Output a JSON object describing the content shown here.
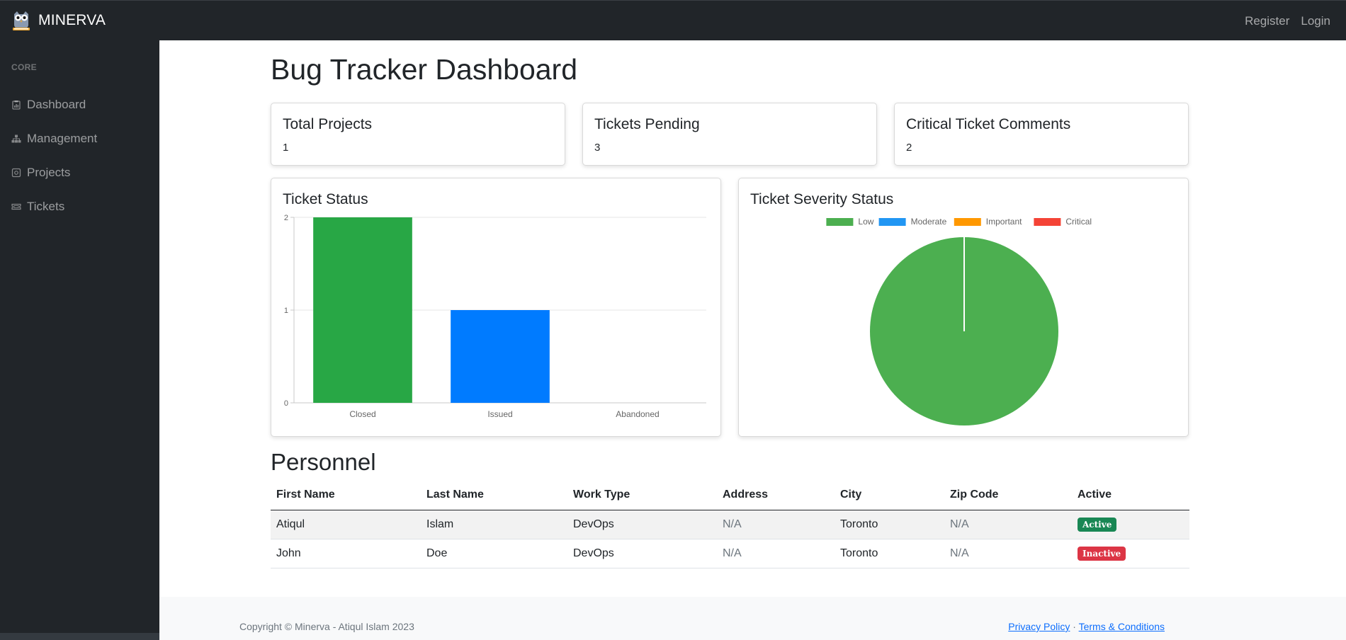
{
  "navbar": {
    "brand": "MINERVA",
    "links": [
      "Register",
      "Login"
    ]
  },
  "sidebar": {
    "heading": "CORE",
    "items": [
      {
        "label": "Dashboard",
        "icon": "clipboard-icon"
      },
      {
        "label": "Management",
        "icon": "sitemap-icon"
      },
      {
        "label": "Projects",
        "icon": "project-icon"
      },
      {
        "label": "Tickets",
        "icon": "ticket-icon"
      }
    ]
  },
  "page": {
    "title": "Bug Tracker Dashboard"
  },
  "stats": [
    {
      "title": "Total Projects",
      "value": "1"
    },
    {
      "title": "Tickets Pending",
      "value": "3"
    },
    {
      "title": "Critical Ticket Comments",
      "value": "2"
    }
  ],
  "charts": {
    "status_title": "Ticket Status",
    "severity_title": "Ticket Severity Status"
  },
  "chart_data": [
    {
      "type": "bar",
      "title": "Ticket Status",
      "categories": [
        "Closed",
        "Issued",
        "Abandoned"
      ],
      "values": [
        2,
        1,
        0
      ],
      "colors": [
        "#28a745",
        "#007bff",
        "#ffc107"
      ],
      "ylim": [
        0,
        2
      ],
      "yticks": [
        "0",
        "1",
        "2"
      ],
      "grid": true,
      "legend": "none"
    },
    {
      "type": "pie",
      "title": "Ticket Severity Status",
      "labels": [
        "Low",
        "Moderate",
        "Important",
        "Critical"
      ],
      "values": [
        1,
        0,
        0,
        0
      ],
      "colors": [
        "#4caf50",
        "#2196f3",
        "#ff9800",
        "#f44336"
      ],
      "legend": "top"
    }
  ],
  "personnel": {
    "title": "Personnel",
    "columns": [
      "First Name",
      "Last Name",
      "Work Type",
      "Address",
      "City",
      "Zip Code",
      "Active"
    ],
    "rows": [
      {
        "first": "Atiqul",
        "last": "Islam",
        "work": "DevOps",
        "address": "N/A",
        "city": "Toronto",
        "zip": "N/A",
        "active": "Active",
        "active_color": "#198754"
      },
      {
        "first": "John",
        "last": "Doe",
        "work": "DevOps",
        "address": "N/A",
        "city": "Toronto",
        "zip": "N/A",
        "active": "Inactive",
        "active_color": "#dc3545"
      }
    ]
  },
  "footer": {
    "copyright": "Copyright © Minerva - Atiqul Islam 2023",
    "privacy": "Privacy Policy",
    "separator": "·",
    "terms": "Terms & Conditions"
  }
}
